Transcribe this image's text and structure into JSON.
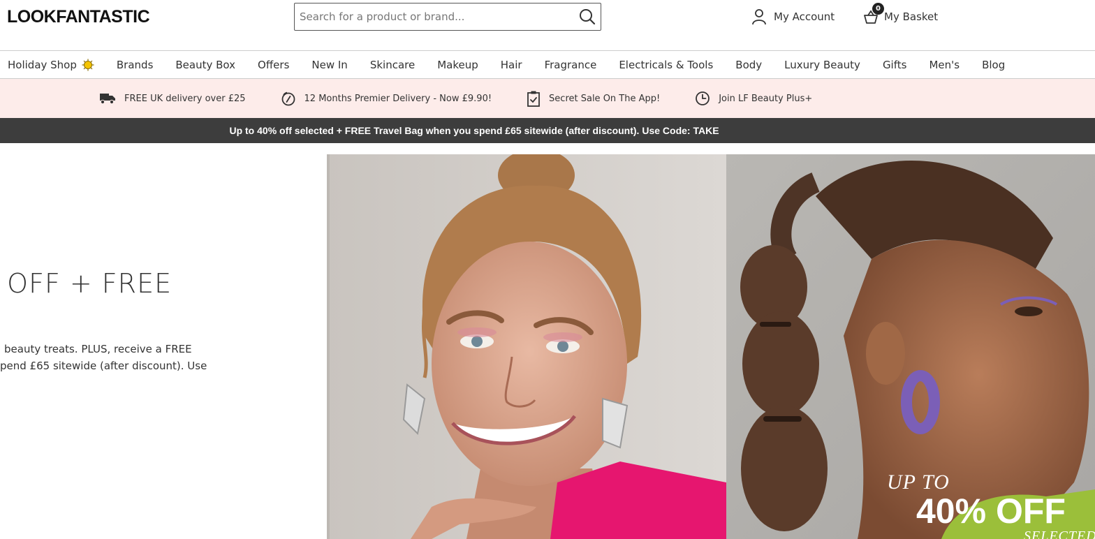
{
  "header": {
    "logo": "LOOKFANTASTIC",
    "search_placeholder": "Search for a product or brand...",
    "account_label": "My Account",
    "basket_label": "My Basket",
    "basket_count": "0"
  },
  "nav": {
    "items": [
      "Holiday Shop",
      "Brands",
      "Beauty Box",
      "Offers",
      "New In",
      "Skincare",
      "Makeup",
      "Hair",
      "Fragrance",
      "Electricals & Tools",
      "Body",
      "Luxury Beauty",
      "Gifts",
      "Men's",
      "Blog"
    ]
  },
  "usp": {
    "items": [
      {
        "icon": "truck-icon",
        "label": "FREE UK delivery over £25"
      },
      {
        "icon": "premier-delivery-icon",
        "label": "12 Months Premier Delivery - Now £9.90!"
      },
      {
        "icon": "clipboard-check-icon",
        "label": "Secret Sale On The App!"
      },
      {
        "icon": "clock-icon",
        "label": "Join LF Beauty Plus+"
      }
    ]
  },
  "promo_bar": {
    "text": "Up to 40% off selected + FREE Travel Bag when you spend £65 sitewide (after discount). Use Code: TAKE"
  },
  "hero": {
    "heading": "% OFF + FREE",
    "body_line1": " beauty treats. PLUS, receive a FREE",
    "body_line2": "pend £65 sitewide (after discount). Use",
    "image_up_to": "UP TO",
    "image_percent": "40% OFF",
    "image_selected": "SELECTED"
  },
  "colors": {
    "usp_background": "#fdecea",
    "promo_background": "#3d3d3d",
    "hero_pink_blazer": "#e6166f",
    "sun_icon": "#f5c400"
  }
}
